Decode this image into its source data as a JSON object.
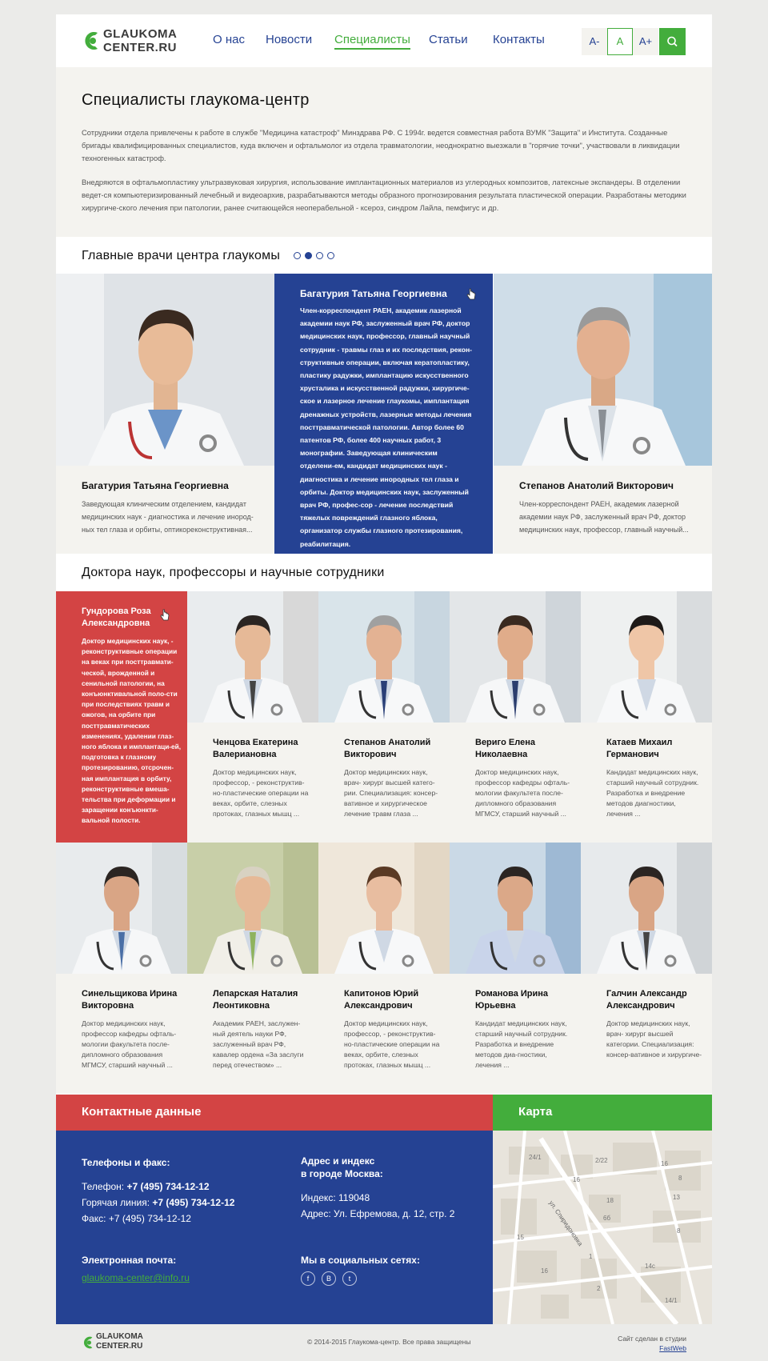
{
  "header": {
    "logo_line1": "GLAUKOMA",
    "logo_line2": "CENTER.RU",
    "nav": [
      "О нас",
      "Новости",
      "Специалисты",
      "Статьи",
      "Контакты"
    ],
    "nav_active": "Специалисты",
    "font_controls": [
      "A-",
      "A",
      "A+"
    ],
    "font_selected": "A",
    "search_icon": "search-icon"
  },
  "intro": {
    "title": "Специалисты глаукома-центр",
    "p1": "Сотрудники отдела привлечены к работе в службе \"Медицина катастроф\" Минздрава РФ. С 1994г. ведется совместная работа ВУМК \"Защита\" и Института. Созданные бригады квалифицированных специалистов, куда включен и офтальмолог из отдела травматологии, неоднократно выезжали в \"горячие точки\", участвовали в ликвидации техногенных катастроф.",
    "p2": "Внедряются в офтальмопластику ультразвуковая хирургия, использование имплантационных материалов из углеродных композитов, латексные экспандеры. В отделении ведет-ся компьютеризированный лечебный и видеоархив, разрабатываются методы образного прогнозирования результата пластической операции. Разработаны методики хирургиче-ского лечения при патологии, ранее считающейся неоперабельной - ксероз, синдром Лайла, пемфигус и др."
  },
  "main_doctors": {
    "title": "Главные врачи центра глаукомы",
    "dots_total": 4,
    "dots_active": 2,
    "cards": [
      {
        "name": "Багатурия Татьяна Георгиевна",
        "desc": "Заведующая клиническим отделением, кандидат медицинских наук - диагностика и лечение инород-ных тел глаза и орбиты, оптикореконструктивная..."
      },
      {
        "name": "Багатурия Татьяна Георгиевна",
        "desc": "Член-корреспондент РАЕН, академик лазерной академии наук РФ, заслуженный врач РФ, доктор медицинских наук, профессор, главный научный сотрудник - травмы глаз и их последствия, рекон-структивные операции, включая кератопластику, пластику радужки, имплантацию искусственного хрусталика и искусственной радужки, хирургиче-ское и лазерное лечение глаукомы, имплантация дренажных устройств, лазерные методы лечения посттравматической патологии. Автор более 60 патентов РФ, более 400 научных работ, 3 монографии. Заведующая клиническим отделени-ем, кандидат медицинских наук - диагностика и лечение инородных тел глаза и орбиты. Доктор медицинских наук, заслуженный врач РФ, профес-сор - лечение последствий тяжелых повреждений глазного яблока, организатор службы глазного протезирования, реабилитация."
      },
      {
        "name": "Степанов Анатолий Викторович",
        "desc": "Член-корреспондент РАЕН, академик лазерной академии наук РФ, заслуженный врач РФ, доктор медицинских наук, профессор, главный научный..."
      }
    ]
  },
  "staff": {
    "title": "Доктора наук, профессоры и научные сотрудники",
    "row1": [
      {
        "name": "Гундорова Роза Александровна",
        "desc": "Доктор медицинских наук, - реконструктивные операции на веках при посттравмати-ческой, врожденной и сенильной патологии, на конъюнктивальной поло-сти при последствиях травм и ожогов, на орбите при посттравматических изменениях, удалении глаз-ного яблока и имплантаци-ей, подготовка к глазному протезированию, отсрочен-ная имплантация в орбиту, реконструктивные вмеша-тельства при деформации и заращении конъюнкти-вальной полости."
      },
      {
        "name": "Ченцова Екатерина Валериановна",
        "desc": "Доктор медицинских наук, профессор, - реконструктив-но-пластические операции на веках, орбите, слезных протоках, глазных мышц ..."
      },
      {
        "name": "Степанов Анатолий Викторович",
        "desc": "Доктор медицинских наук, врач- хирург высшей катего-рии. Специализация: консер-вативное и хирургическое лечение травм глаза ..."
      },
      {
        "name": "Веригo Елена Николаевна",
        "desc": "Доктор медицинских наук, профессор кафедры офталь-мологии факультета после-дипломного образования МГМСУ, старший научный ..."
      },
      {
        "name": "Катаев Михаил Германович",
        "desc": "Кандидат медицинских наук, старший научный сотрудник. Разработка и внедрение методов диагностики, лечения ..."
      }
    ],
    "row2": [
      {
        "name": "Синельщикова Ирина Викторовна",
        "desc": "Доктор медицинских наук, профессор кафедры офталь-мологии факультета после-дипломного образования МГМСУ, старший научный ..."
      },
      {
        "name": "Лепарская Наталия Леонтиковна",
        "desc": "Академик РАЕН, заслужен-ный деятель науки РФ, заслуженный врач РФ, кавалер ордена «За заслуги перед отечеством» ..."
      },
      {
        "name": "Капитонов Юрий Александрович",
        "desc": "Доктор медицинских наук, профессор, - реконструктив-но-пластические операции на веках, орбите, слезных протоках, глазных мышц ..."
      },
      {
        "name": "Романова Ирина Юрьевна",
        "desc": "Кандидат медицинских наук, старший научный сотрудник. Разработка и внедрение методов диа-гностики, лечения ..."
      },
      {
        "name": "Галчин Александр Александрович",
        "desc": "Доктор медицинских наук, врач- хирург высшей категории. Специализация: консер-вативное и хирургиче-"
      }
    ]
  },
  "contacts": {
    "title": "Контактные данные",
    "map_title": "Карта",
    "phones_title": "Телефоны и факс:",
    "phone_label": "Телефон: ",
    "phone": "+7 (495) 734-12-12",
    "hotline_label": "Горячая линия: ",
    "hotline": "+7 (495) 734-12-12",
    "fax": "Факс: +7 (495) 734-12-12",
    "address_title_1": "Адрес и индекс",
    "address_title_2": "в городе Москва:",
    "index": "Индекс: 119048",
    "address": "Адрес: Ул. Ефремова, д. 12, стр. 2",
    "email_title": "Электронная почта:",
    "email": "glaukoma-center@info.ru",
    "social_title": "Мы в социальных сетях:",
    "social": [
      "f",
      "B",
      "t"
    ]
  },
  "map_labels": [
    "24/1",
    "2/22",
    "16",
    "8",
    "16",
    "18",
    "13",
    "6б",
    "8",
    "ул. Спиридоновка",
    "15",
    "1",
    "14с",
    "16",
    "2",
    "14/1"
  ],
  "footer": {
    "logo_line1": "GLAUKOMA",
    "logo_line2": "CENTER.RU",
    "copyright": "© 2014-2015  Глаукома-центр. Все права защищены",
    "studio_text": "Сайт сделан в студии",
    "studio_link": "FastWeb"
  },
  "colors": {
    "blue": "#254293",
    "green": "#43ad3c",
    "red": "#d34444",
    "light": "#f4f3ef"
  }
}
